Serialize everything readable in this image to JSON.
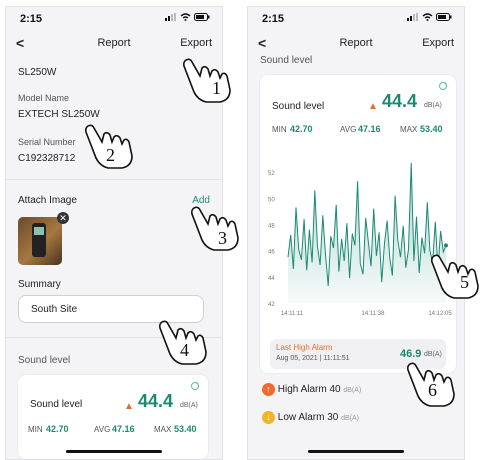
{
  "left": {
    "status": {
      "time": "2:15"
    },
    "nav": {
      "back": "<",
      "title": "Report",
      "export": "Export"
    },
    "device_name": "SL250W",
    "model": {
      "label": "Model Name",
      "value": "EXTECH SL250W"
    },
    "serial": {
      "label": "Serial Number",
      "value": "C192328712"
    },
    "attach": {
      "label": "Attach Image",
      "add": "Add"
    },
    "summary": {
      "label": "Summary",
      "value": "South Site"
    },
    "sound_section": "Sound level",
    "card": {
      "label": "Sound level",
      "value": "44.4",
      "unit": "dB(A)",
      "min_label": "MIN",
      "min": "42.70",
      "avg_label": "AVG",
      "avg": "47.16",
      "max_label": "MAX",
      "max": "53.40"
    },
    "callouts": [
      "1",
      "2",
      "3",
      "4"
    ]
  },
  "right": {
    "status": {
      "time": "2:15"
    },
    "nav": {
      "back": "<",
      "title": "Report",
      "export": "Export"
    },
    "section": "Sound level",
    "card": {
      "label": "Sound level",
      "value": "44.4",
      "unit": "dB(A)",
      "min_label": "MIN",
      "min": "42.70",
      "avg_label": "AVG",
      "avg": "47.16",
      "max_label": "MAX",
      "max": "53.40"
    },
    "alarm_box": {
      "title": "Last High Alarm",
      "date": "Aug 05, 2021 | 11:11:51",
      "value": "46.9",
      "unit": "dB(A)"
    },
    "high_alarm": {
      "label": "High Alarm",
      "value": "40",
      "unit": "dB(A)"
    },
    "low_alarm": {
      "label": "Low Alarm",
      "value": "30",
      "unit": "dB(A)"
    },
    "callouts": [
      "5",
      "6"
    ]
  },
  "colors": {
    "accent": "#1a8a73",
    "warning": "#e0702a",
    "alarm_up": "#ef6b2d",
    "alarm_down": "#f1b52a"
  },
  "chart_data": {
    "type": "area",
    "y_ticks": [
      "52",
      "50",
      "48",
      "46",
      "44",
      "42"
    ],
    "x_ticks": [
      "14:11:11",
      "14:11:38",
      "14:12:05"
    ],
    "ylim": [
      42,
      53
    ],
    "values": [
      45.5,
      47.2,
      44.6,
      49.3,
      46.1,
      45.3,
      48.4,
      44.5,
      47.6,
      45.1,
      50.6,
      46.3,
      44.9,
      48.7,
      45.7,
      43.3,
      47.1,
      46.2,
      49.5,
      44.4,
      46.9,
      45.2,
      48.1,
      43.9,
      47.3,
      46.4,
      51.3,
      45.0,
      44.2,
      48.5,
      46.7,
      44.8,
      49.2,
      45.6,
      47.4,
      43.6,
      46.5,
      48.3,
      45.4,
      44.1,
      50.2,
      46.8,
      45.5,
      47.9,
      44.7,
      46.1,
      52.7,
      45.2,
      48.6,
      44.3,
      47.0,
      45.8,
      49.7,
      46.0,
      45.1,
      48.2,
      44.6,
      47.5,
      45.9,
      46.4
    ],
    "grid": false
  }
}
